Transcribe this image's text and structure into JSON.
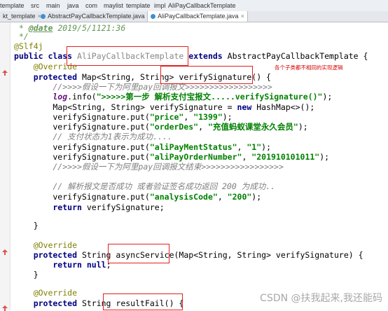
{
  "breadcrumb": [
    "template",
    "src",
    "main",
    "java",
    "com",
    "maylist",
    "template",
    "impl",
    "AliPayCallbackTemplate"
  ],
  "tabs": [
    {
      "label": "kt_template",
      "active": false
    },
    {
      "label": "AbstractPayCallbackTemplate.java",
      "active": false
    },
    {
      "label": "AliPayCallbackTemplate.java",
      "active": true
    }
  ],
  "code": {
    "l1_star": " * ",
    "l1_tag": "@date",
    "l1_rest": " 2019/5/1121:36",
    "l2": " */",
    "l3": "@Slf4j",
    "l4_kw": "public class ",
    "l4_name": "AliPayCallbackTemplate",
    "l4_ext": " extends ",
    "l4_base": "AbstractPayCallbackTemplate {",
    "l5": "    @Override",
    "l6_kw": "    protected ",
    "l6_type": "Map<String, String> ",
    "l6_name": "verifySignature",
    "l6_rest": "() {",
    "l7": "        //>>>>假设一下为阿里pay回调报文>>>>>>>>>>>>>>>>>>",
    "l8_log": "        log",
    "l8_info": ".info(",
    "l8_str": "\">>>>>第一步 解析支付宝报文.....verifySignature()\"",
    "l8_end": ");",
    "l9_a": "        Map<String, String> verifySignature = ",
    "l9_new": "new",
    "l9_b": " HashMap<>();",
    "l10_a": "        verifySignature.put(",
    "l10_k": "\"price\"",
    "l10_m": ", ",
    "l10_v": "\"1399\"",
    "l10_e": ");",
    "l11_a": "        verifySignature.put(",
    "l11_k": "\"orderDes\"",
    "l11_m": ", ",
    "l11_v": "\"充值蚂蚁课堂永久会员\"",
    "l11_e": ");",
    "l12": "        // 支付状态为1表示为成功....",
    "l13_a": "        verifySignature.put(",
    "l13_k": "\"aliPayMentStatus\"",
    "l13_m": ", ",
    "l13_v": "\"1\"",
    "l13_e": ");",
    "l14_a": "        verifySignature.put(",
    "l14_k": "\"aliPayOrderNumber\"",
    "l14_m": ", ",
    "l14_v": "\"201910101011\"",
    "l14_e": ");",
    "l15": "        //>>>>假设一下为阿里pay回调报文结束>>>>>>>>>>>>>>>>>",
    "l17": "        // 解析报文是否成功 或者验证签名成功返回 200 为成功..",
    "l18_a": "        verifySignature.put(",
    "l18_k": "\"analysisCode\"",
    "l18_m": ", ",
    "l18_v": "\"200\"",
    "l18_e": ");",
    "l19_kw": "        return ",
    "l19_rest": "verifySignature;",
    "l21": "    }",
    "l23": "    @Override",
    "l24_kw": "    protected ",
    "l24_type": "String ",
    "l24_name": "asyncService",
    "l24_rest": "(Map<String, String> verifySignature) {",
    "l25_kw": "        return ",
    "l25_null": "null",
    "l25_end": ";",
    "l26": "    }",
    "l28": "    @Override",
    "l29_kw": "    protected ",
    "l29_type": "String ",
    "l29_name": "resultFail",
    "l29_rest": "() {"
  },
  "annotation_note": "各个子类都不相同的实现逻辑",
  "watermark": "CSDN @扶我起来,我还能码",
  "colors": {
    "highlight_box": "#e02020",
    "keyword": "#000080",
    "string": "#008000",
    "comment": "#808080",
    "annotation": "#808000"
  }
}
